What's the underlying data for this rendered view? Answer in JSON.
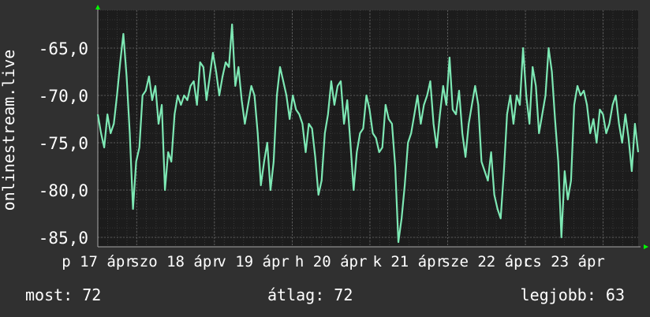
{
  "chart_data": {
    "type": "line",
    "ylabel": "onlinestream.live",
    "y_ticks": [
      "-65,0",
      "-70,0",
      "-75,0",
      "-80,0",
      "-85,0"
    ],
    "y_tick_values": [
      -65,
      -70,
      -75,
      -80,
      -85
    ],
    "ylim": [
      -86,
      -61
    ],
    "x_ticks": [
      "p 17 ápr",
      "szo 18 ápr",
      "v 19 ápr",
      "h 20 ápr",
      "k 21 ápr",
      "sze 22 ápr",
      "cs 23 ápr"
    ],
    "x_tick_positions": [
      0.5,
      1.5,
      2.5,
      3.5,
      4.5,
      5.5,
      6.5
    ],
    "xlim": [
      0.5,
      7.45
    ],
    "grid": true,
    "series": [
      {
        "color": "#7de8b4",
        "values": [
          -72,
          -74,
          -75.5,
          -72,
          -74,
          -73,
          -70,
          -66.5,
          -63.5,
          -68,
          -74,
          -82,
          -77,
          -75.5,
          -70,
          -69.5,
          -68,
          -70.5,
          -69,
          -73,
          -71,
          -80,
          -76,
          -77,
          -72,
          -70,
          -71,
          -70,
          -70.5,
          -69,
          -68.5,
          -71,
          -66.5,
          -67,
          -70.5,
          -68,
          -65.5,
          -67.5,
          -70,
          -68,
          -66.5,
          -67,
          -62.5,
          -69,
          -67,
          -70.5,
          -73,
          -71,
          -69,
          -70,
          -74,
          -79.5,
          -77,
          -75,
          -80,
          -77,
          -70,
          -67,
          -68.5,
          -70,
          -72.5,
          -70,
          -71.5,
          -72,
          -73,
          -76,
          -73,
          -73.5,
          -76.5,
          -80.5,
          -79,
          -74,
          -72,
          -68.5,
          -71,
          -69,
          -68.5,
          -73,
          -70.5,
          -75,
          -80,
          -76,
          -74,
          -73.5,
          -70,
          -71.5,
          -74,
          -74.5,
          -76,
          -75.5,
          -71,
          -72.5,
          -73,
          -77.5,
          -85.5,
          -83,
          -79.5,
          -75,
          -74,
          -72,
          -70,
          -73,
          -71,
          -70,
          -68.5,
          -73,
          -75.5,
          -72,
          -69,
          -71,
          -66,
          -71.5,
          -72,
          -69.5,
          -74,
          -76.5,
          -73,
          -71,
          -69,
          -71,
          -77,
          -78,
          -79,
          -76,
          -80.5,
          -82,
          -83,
          -78,
          -72,
          -70,
          -73,
          -70,
          -71,
          -65,
          -70,
          -73,
          -67,
          -69,
          -74,
          -72,
          -70,
          -65,
          -67.5,
          -72.5,
          -77,
          -85,
          -78,
          -81,
          -79,
          -71,
          -69,
          -70,
          -69.5,
          -71,
          -74,
          -72.5,
          -75,
          -71.5,
          -72,
          -74,
          -73,
          -71,
          -70,
          -73,
          -75,
          -72,
          -74.5,
          -78,
          -73,
          -76
        ]
      }
    ]
  },
  "stats": {
    "current": "most: 72",
    "average": "átlag: 72",
    "best": "legjobb: 63"
  },
  "colors": {
    "background": "#303030",
    "plot_background": "#1c1c1c",
    "grid": "#4a4a4a",
    "line": "#7de8b4",
    "axis_arrow": "#00ff00",
    "text": "#ffffff"
  }
}
